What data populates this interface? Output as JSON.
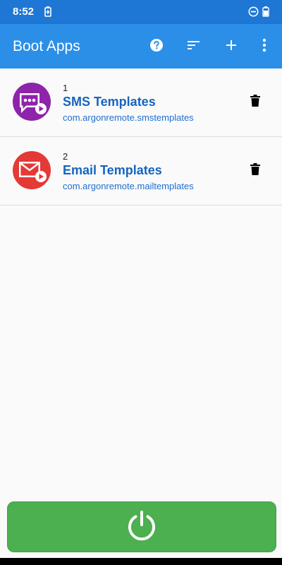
{
  "status_bar": {
    "time": "8:52",
    "icons": [
      "battery-saver-icon",
      "do-not-disturb-icon",
      "battery-icon"
    ]
  },
  "app_bar": {
    "title": "Boot Apps",
    "actions": [
      "help-icon",
      "sort-icon",
      "add-icon",
      "overflow-menu-icon"
    ]
  },
  "apps": [
    {
      "order": "1",
      "name": "SMS Templates",
      "package": "com.argonremote.smstemplates",
      "icon": "sms-templates-icon",
      "icon_color": "#8e24aa"
    },
    {
      "order": "2",
      "name": "Email Templates",
      "package": "com.argonremote.mailtemplates",
      "icon": "email-templates-icon",
      "icon_color": "#e53935"
    }
  ],
  "power_button": {
    "icon": "power-icon",
    "color": "#4caf50"
  },
  "colors": {
    "status_bar": "#1e77d4",
    "app_bar": "#2b8fe8",
    "title_text": "#1565c0",
    "package_text": "#1e6fcf"
  }
}
